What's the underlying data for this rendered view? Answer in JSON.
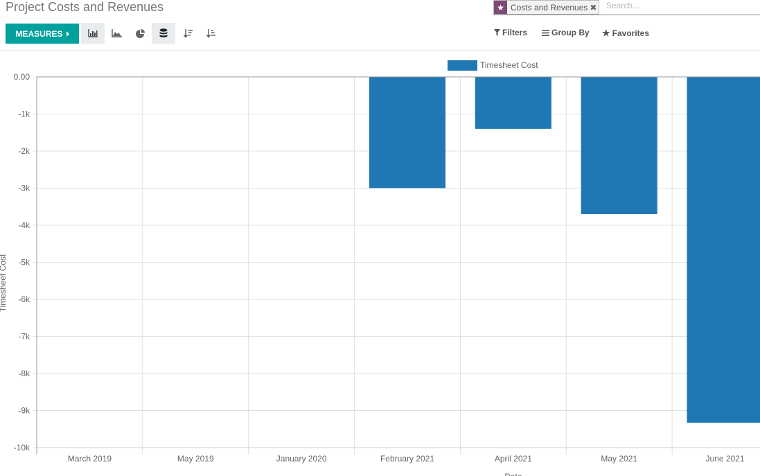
{
  "page_title": "Project Costs and Revenues",
  "toolbar": {
    "measures_label": "MEASURES",
    "views": [
      {
        "name": "bar-chart",
        "active": true
      },
      {
        "name": "line-chart",
        "active": false
      },
      {
        "name": "pie-chart",
        "active": false
      },
      {
        "name": "stacked",
        "active": true
      },
      {
        "name": "sort-descending",
        "active": false
      },
      {
        "name": "sort-ascending",
        "active": false
      }
    ]
  },
  "search": {
    "facet_label": "Costs and Revenues",
    "placeholder": "Search..."
  },
  "options": {
    "filters_label": "Filters",
    "groupby_label": "Group By",
    "favorites_label": "Favorites"
  },
  "colors": {
    "bar": "#1f77b4",
    "accent": "#00A09D",
    "facet": "#7c4a74"
  },
  "chart_data": {
    "type": "bar",
    "categories": [
      "March 2019",
      "May 2019",
      "January 2020",
      "February 2021",
      "April 2021",
      "May 2021",
      "June 2021"
    ],
    "series": [
      {
        "name": "Timesheet Cost",
        "values": [
          0,
          0,
          0,
          -3000,
          -1400,
          -3700,
          -9330
        ]
      }
    ],
    "xlabel": "Date",
    "ylabel": "Timesheet Cost",
    "ylim": [
      -10000,
      0
    ],
    "yticks": [
      0,
      -1000,
      -2000,
      -3000,
      -4000,
      -5000,
      -6000,
      -7000,
      -8000,
      -9000,
      -10000
    ],
    "ytick_labels": [
      "0.00",
      "-1k",
      "-2k",
      "-3k",
      "-4k",
      "-5k",
      "-6k",
      "-7k",
      "-8k",
      "-9k",
      "-10k"
    ],
    "grid": true,
    "legend": "top-center"
  }
}
